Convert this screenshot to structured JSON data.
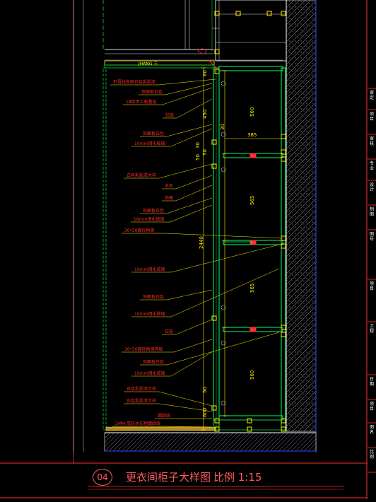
{
  "drawing_title": "更衣间柜子大样图",
  "scale_text": "比例 1:15",
  "detail_number": "04",
  "ceiling_label": "JHANG 三",
  "annotations": [
    "石膏线条刷白色乳胶漆",
    "饰面板白色",
    "18厚木工板基层",
    "铰链",
    "饰面板白色",
    "10mm钢化玻璃",
    "白色乳胶漆大样",
    "木条",
    "饰面",
    "饰面板白色",
    "18mm钢化玻璃",
    "30*30镀锌角钢",
    "10mm钢化玻璃",
    "饰面板白色",
    "10mm钢化玻璃",
    "铰链",
    "30*30镀锌角钢焊接",
    "饰面板白色",
    "10mm钢化玻璃",
    "白色乳胶漆大样",
    "白色乳胶漆大样",
    "踢脚线",
    "2MM 厚防水石材踢脚线"
  ],
  "dimensions": {
    "shelf1": "560",
    "gap1": "385",
    "shelf2": "565",
    "shelf3": "565",
    "shelf4": "560",
    "total": "2440",
    "d30a": "30",
    "d50a": "50",
    "d30b": "30",
    "d50b": "50",
    "d450": "450",
    "d600": "600",
    "d50c": "50",
    "d80": "80"
  },
  "title_block": [
    "审定",
    "项目",
    "审核",
    "专业",
    "设计",
    "制图",
    "图号",
    "项目",
    "工程",
    "日期",
    "项目",
    "图名",
    "比例"
  ],
  "colors": {
    "annotation": "#ff2a2a",
    "dimension": "#ffee00",
    "structure": "#00cc44",
    "cabinet": "#00ff66",
    "wall_hatch": "#9a9a9a",
    "frame": "#ff3030",
    "boundary": "#3344ff"
  }
}
